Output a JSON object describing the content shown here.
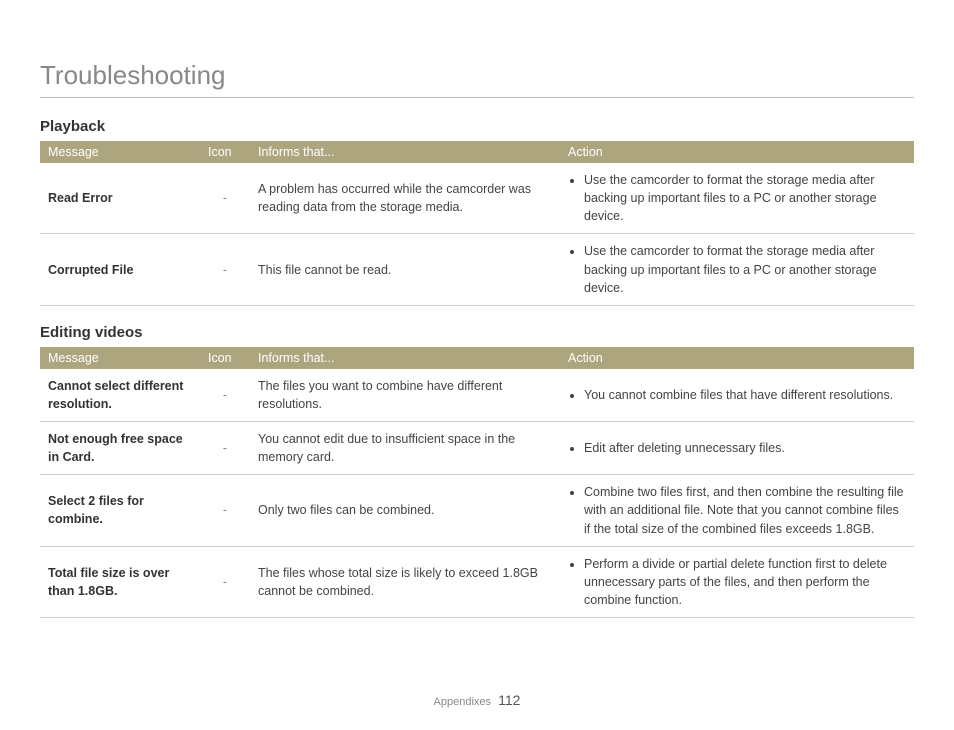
{
  "pageTitle": "Troubleshooting",
  "footer": {
    "label": "Appendixes",
    "page": "112"
  },
  "headers": {
    "message": "Message",
    "icon": "Icon",
    "informs": "Informs that...",
    "action": "Action"
  },
  "sections": [
    {
      "title": "Playback",
      "rows": [
        {
          "message": "Read Error",
          "icon": "-",
          "informs": "A problem has occurred while the camcorder was reading data from the storage media.",
          "actions": [
            "Use the camcorder to format the storage media after backing up important files to a PC or another storage device."
          ]
        },
        {
          "message": "Corrupted File",
          "icon": "-",
          "informs": "This file cannot be read.",
          "actions": [
            "Use the camcorder to format the storage media after backing up important files to a PC or another storage device."
          ]
        }
      ]
    },
    {
      "title": "Editing videos",
      "rows": [
        {
          "message": "Cannot select different resolution.",
          "icon": "-",
          "informs": "The files you want to combine have different resolutions.",
          "actions": [
            "You cannot combine files that have different resolutions."
          ]
        },
        {
          "message": "Not enough free space in Card.",
          "icon": "-",
          "informs": "You cannot edit due to insufficient space in the memory card.",
          "actions": [
            "Edit after deleting unnecessary files."
          ]
        },
        {
          "message": "Select 2 files for combine.",
          "icon": "-",
          "informs": "Only two files can be combined.",
          "actions": [
            "Combine two files first, and then combine the resulting file with an additional file. Note that you cannot combine files if the total size of the combined files exceeds 1.8GB."
          ]
        },
        {
          "message": "Total file size is over than 1.8GB.",
          "icon": "-",
          "informs": "The files whose total size is likely to exceed 1.8GB cannot be combined.",
          "actions": [
            "Perform a divide or partial delete function first to delete unnecessary parts of the files, and then perform the combine function."
          ]
        }
      ]
    }
  ]
}
